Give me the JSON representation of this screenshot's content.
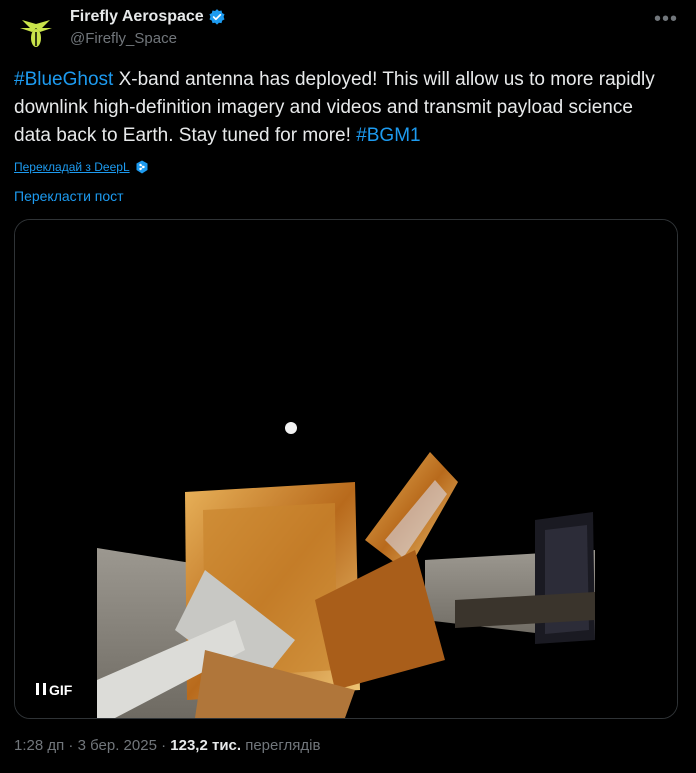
{
  "author": {
    "display_name": "Firefly Aerospace",
    "handle": "@Firefly_Space",
    "verified": true,
    "avatar_icon": "firefly-logo-icon",
    "accent_color": "#c9e34a"
  },
  "tweet": {
    "hashtag_1": "#BlueGhost",
    "text_1": " X-band antenna has deployed! This will allow us to more rapidly downlink high-definition imagery and videos and transmit payload science data back to Earth. Stay tuned for more! ",
    "hashtag_2": "#BGM1"
  },
  "translate": {
    "deepl_label": "Перекладай з DeepL",
    "post_label": "Перекласти пост"
  },
  "media": {
    "gif_label": "GIF",
    "pause_icon": "pause-icon"
  },
  "footer": {
    "time": "1:28 дп",
    "separator": " · ",
    "date": "3 бер. 2025",
    "views_count": "123,2 тис.",
    "views_label": "переглядів"
  },
  "colors": {
    "link": "#1d9bf0",
    "text": "#e7e9ea",
    "muted": "#71767b",
    "background": "#000000"
  }
}
